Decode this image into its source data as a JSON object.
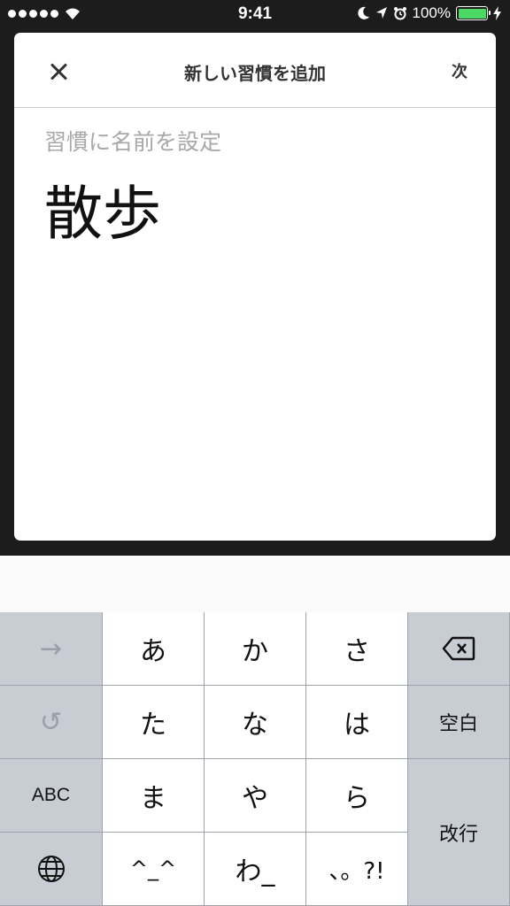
{
  "status_bar": {
    "time": "9:41",
    "battery_percent": "100%",
    "battery_level": 1.0,
    "icons": [
      "signal-dots-icon",
      "wifi-icon",
      "moon-icon",
      "location-arrow-icon",
      "alarm-icon",
      "battery-icon",
      "charging-bolt-icon"
    ]
  },
  "header": {
    "title": "新しい習慣を追加",
    "next_label": "次",
    "close_icon": "close-icon"
  },
  "form": {
    "label": "習慣に名前を設定",
    "value": "散歩"
  },
  "keyboard": {
    "row1": {
      "left": "→",
      "keys": [
        "あ",
        "か",
        "さ"
      ],
      "right_icon": "backspace-icon"
    },
    "row2": {
      "left": "↺",
      "keys": [
        "た",
        "な",
        "は"
      ],
      "right": "空白"
    },
    "row3": {
      "left": "ABC",
      "keys": [
        "ま",
        "や",
        "ら"
      ]
    },
    "row4": {
      "left_icon": "globe-icon",
      "keys": [
        "^_^",
        "わ_",
        "、。?!"
      ]
    },
    "return_label": "改行"
  },
  "colors": {
    "battery_green": "#4cd964",
    "keyboard_bg": "#d1d5db",
    "placeholder_gray": "#a8a8a8"
  }
}
